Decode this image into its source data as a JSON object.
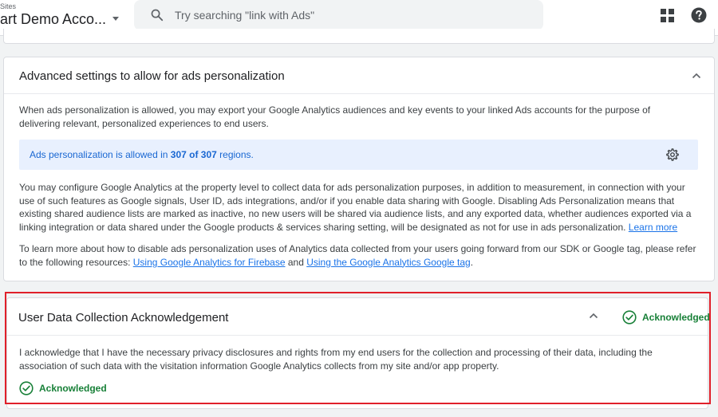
{
  "header": {
    "breadcrumb": "Sites",
    "account_name": "art Demo Acco...",
    "search_placeholder": "Try searching \"link with Ads\"",
    "icons": {
      "search": "search-icon",
      "apps": "apps-grid-icon",
      "help": "help-icon"
    }
  },
  "advanced": {
    "title": "Advanced settings to allow for ads personalization",
    "intro": "When ads personalization is allowed, you may export your Google Analytics audiences and key events to your linked Ads accounts for the purpose of delivering relevant, personalized experiences to end users.",
    "banner": {
      "prefix": "Ads personalization is allowed in ",
      "count": "307 of 307",
      "suffix": " regions."
    },
    "paragraph": "You may configure Google Analytics at the property level to collect data for ads personalization purposes, in addition to measurement, in connection with your use of such features as Google signals, User ID, ads integrations, and/or if you enable data sharing with Google. Disabling Ads Personalization means that existing shared audience lists are marked as inactive, no new users will be shared via audience lists, and any exported data, whether audiences exported via a linking integration or data shared under the Google products & services sharing setting, will be designated as not for use in ads personalization.",
    "learn_more": "Learn more",
    "resources_prefix": "To learn more about how to disable ads personalization uses of Analytics data collected from your users going forward from our SDK or Google tag, please refer to the following resources: ",
    "link_firebase": "Using Google Analytics for Firebase",
    "resources_and": " and ",
    "link_gtag": "Using the Google Analytics Google tag",
    "resources_end": "."
  },
  "user_data": {
    "title": "User Data Collection Acknowledgement",
    "status_label": "Acknowledged",
    "body": "I acknowledge that I have the necessary privacy disclosures and rights from my end users for the collection and processing of their data, including the association of such data with the visitation information Google Analytics collects from my site and/or app property.",
    "footer_status": "Acknowledged"
  },
  "colors": {
    "accent": "#1a73e8",
    "success": "#188038",
    "highlight": "#e0202a",
    "banner_bg": "#e8f0fe"
  }
}
